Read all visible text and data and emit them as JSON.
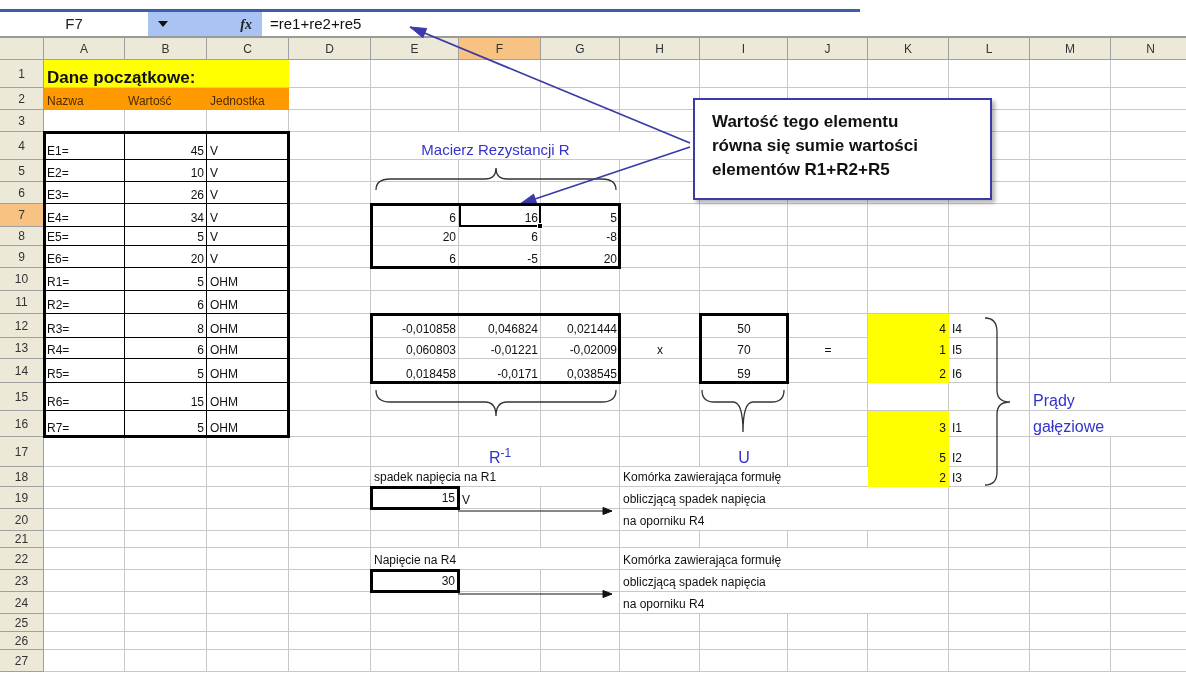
{
  "name_box": "F7",
  "function_button": "fx",
  "formula": "=re1+re2+re5",
  "columns": [
    {
      "label": "A",
      "selected": false
    },
    {
      "label": "B",
      "selected": false
    },
    {
      "label": "C",
      "selected": false
    },
    {
      "label": "D",
      "selected": false
    },
    {
      "label": "E",
      "selected": false
    },
    {
      "label": "F",
      "selected": true
    },
    {
      "label": "G",
      "selected": false
    },
    {
      "label": "H",
      "selected": false
    },
    {
      "label": "I",
      "selected": false
    },
    {
      "label": "J",
      "selected": false
    },
    {
      "label": "K",
      "selected": false
    },
    {
      "label": "L",
      "selected": false
    },
    {
      "label": "M",
      "selected": false
    },
    {
      "label": "N",
      "selected": false
    }
  ],
  "rows": [
    {
      "label": "1",
      "selected": false,
      "cells": {
        "A": "Dane początkowe:"
      }
    },
    {
      "label": "2",
      "selected": false,
      "cells": {
        "A": "Nazwa",
        "B": "Wartość",
        "C": "Jednostka"
      }
    },
    {
      "label": "3",
      "selected": false
    },
    {
      "label": "4",
      "selected": false,
      "cells": {
        "A": "E1=",
        "B": "45",
        "C": "V",
        "E": "Macierz Rezystancji R"
      }
    },
    {
      "label": "5",
      "selected": false,
      "cells": {
        "A": "E2=",
        "B": "10",
        "C": "V"
      }
    },
    {
      "label": "6",
      "selected": false,
      "cells": {
        "A": "E3=",
        "B": "26",
        "C": "V"
      }
    },
    {
      "label": "7",
      "selected": true,
      "cells": {
        "A": "E4=",
        "B": "34",
        "C": "V",
        "E": "6",
        "F": "16",
        "G": "5"
      }
    },
    {
      "label": "8",
      "selected": false,
      "cells": {
        "A": "E5=",
        "B": "5",
        "C": "V",
        "E": "20",
        "F": "6",
        "G": "-8"
      }
    },
    {
      "label": "9",
      "selected": false,
      "cells": {
        "A": "E6=",
        "B": "20",
        "C": "V",
        "E": "6",
        "F": "-5",
        "G": "20"
      }
    },
    {
      "label": "10",
      "selected": false,
      "cells": {
        "A": "R1=",
        "B": "5",
        "C": "OHM"
      }
    },
    {
      "label": "11",
      "selected": false,
      "cells": {
        "A": "R2=",
        "B": "6",
        "C": "OHM"
      }
    },
    {
      "label": "12",
      "selected": false,
      "cells": {
        "A": "R3=",
        "B": "8",
        "C": "OHM",
        "E": "-0,010858",
        "F": "0,046824",
        "G": "0,021444",
        "I": "50",
        "K": "4",
        "L": "I4"
      }
    },
    {
      "label": "13",
      "selected": false,
      "cells": {
        "A": "R4=",
        "B": "6",
        "C": "OHM",
        "E": "0,060803",
        "F": "-0,01221",
        "G": "-0,02009",
        "H": "x",
        "I": "70",
        "J": "=",
        "K": "1",
        "L": "I5"
      }
    },
    {
      "label": "14",
      "selected": false,
      "cells": {
        "A": "R5=",
        "B": "5",
        "C": "OHM",
        "E": "0,018458",
        "F": "-0,0171",
        "G": "0,038545",
        "I": "59",
        "K": "2",
        "L": "I6"
      }
    },
    {
      "label": "15",
      "selected": false,
      "cells": {
        "A": "R6=",
        "B": "15",
        "C": "OHM",
        "M": "Prądy"
      }
    },
    {
      "label": "16",
      "selected": false,
      "cells": {
        "A": "R7=",
        "B": "5",
        "C": "OHM",
        "K": "3",
        "L": "I1",
        "M": "gałęziowe"
      }
    },
    {
      "label": "17",
      "selected": false,
      "cells": {
        "F": "R$^{-1}$",
        "I": "U",
        "K": "5",
        "L": "I2"
      }
    },
    {
      "label": "18",
      "selected": false,
      "cells": {
        "E": "spadek napięcia na R1",
        "H": "Komórka zawierająca formułę",
        "K": "2",
        "L": "I3"
      }
    },
    {
      "label": "19",
      "selected": false,
      "cells": {
        "E": "15",
        "F": "V",
        "H": "obliczjącą spadek napięcia"
      }
    },
    {
      "label": "20",
      "selected": false,
      "cells": {
        "H": "na oporniku R4"
      }
    },
    {
      "label": "21",
      "selected": false
    },
    {
      "label": "22",
      "selected": false,
      "cells": {
        "E": "Napięcie na R4",
        "H": "Komórka zawierająca formułę"
      }
    },
    {
      "label": "23",
      "selected": false,
      "cells": {
        "E": "30",
        "H": "obliczjącą spadek napięcia"
      }
    },
    {
      "label": "24",
      "selected": false,
      "cells": {
        "H": "na oporniku R4"
      }
    },
    {
      "label": "25",
      "selected": false
    },
    {
      "label": "26",
      "selected": false
    },
    {
      "label": "27",
      "selected": false
    }
  ],
  "callout": "Wartość tego elementu równa się sumie wartości elementów R1+R2+R5"
}
